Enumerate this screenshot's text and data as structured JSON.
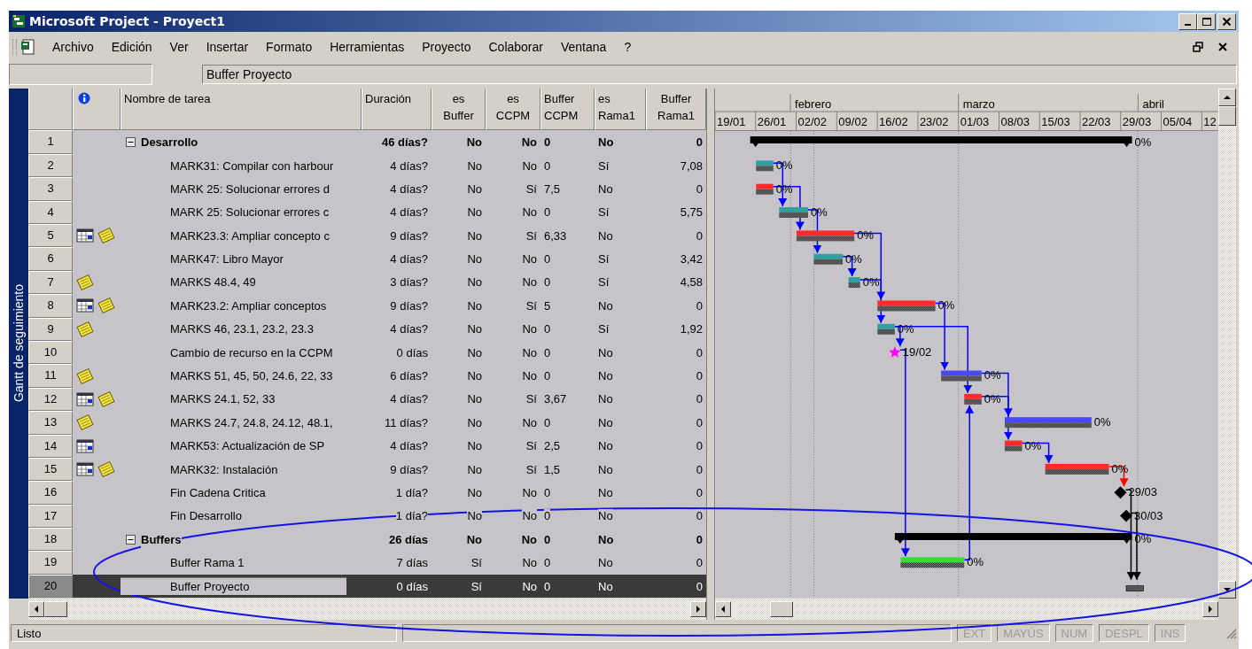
{
  "window": {
    "title": "Microsoft Project - Proyect1"
  },
  "menu": [
    "Archivo",
    "Edición",
    "Ver",
    "Insertar",
    "Formato",
    "Herramientas",
    "Proyecto",
    "Colaborar",
    "Ventana",
    "?"
  ],
  "entry_bar": {
    "value": "Buffer Proyecto"
  },
  "view_bar": {
    "label": "Gantt de seguimiento"
  },
  "columns": [
    "Nombre de tarea",
    "Duración",
    "es Buffer",
    "es CCPM",
    "Buffer CCPM",
    "es Rama1",
    "Buffer Rama1"
  ],
  "tasks": [
    {
      "row_number": "1",
      "name": "Desarrollo",
      "expanded": true,
      "selected": false,
      "values": [
        "46 días?",
        "No",
        "No",
        "0",
        "No",
        "0"
      ],
      "children": [
        {
          "row_number": "2",
          "name": "MARK31: Compilar con harbour",
          "selected": false,
          "values": [
            "4 días?",
            "No",
            "No",
            "0",
            "Sí",
            "7,08"
          ]
        },
        {
          "row_number": "3",
          "name": "MARK 25: Solucionar errores d",
          "selected": false,
          "values": [
            "4 días?",
            "No",
            "Sí",
            "7,5",
            "No",
            "0"
          ]
        },
        {
          "row_number": "4",
          "name": "MARK 25: Solucionar errores c",
          "selected": false,
          "values": [
            "4 días?",
            "No",
            "No",
            "0",
            "Sí",
            "5,75"
          ]
        },
        {
          "row_number": "5",
          "name": "MARK23.3: Ampliar concepto c",
          "selected": false,
          "indicators": [
            {
              "kind": "calendar"
            },
            {
              "kind": "note"
            }
          ],
          "values": [
            "9 días?",
            "No",
            "Sí",
            "6,33",
            "No",
            "0"
          ]
        },
        {
          "row_number": "6",
          "name": "MARK47: Libro Mayor",
          "selected": false,
          "values": [
            "4 días?",
            "No",
            "No",
            "0",
            "Sí",
            "3,42"
          ]
        },
        {
          "row_number": "7",
          "name": "MARKS 48.4, 49",
          "selected": false,
          "indicators": [
            {
              "kind": "note"
            }
          ],
          "values": [
            "3 días?",
            "No",
            "No",
            "0",
            "Sí",
            "4,58"
          ]
        },
        {
          "row_number": "8",
          "name": "MARK23.2: Ampliar conceptos",
          "selected": false,
          "indicators": [
            {
              "kind": "calendar"
            },
            {
              "kind": "note"
            }
          ],
          "values": [
            "9 días?",
            "No",
            "Sí",
            "5",
            "No",
            "0"
          ]
        },
        {
          "row_number": "9",
          "name": "MARKS 46, 23.1, 23.2, 23.3",
          "selected": false,
          "indicators": [
            {
              "kind": "note"
            }
          ],
          "values": [
            "4 días?",
            "No",
            "No",
            "0",
            "Sí",
            "1,92"
          ]
        },
        {
          "row_number": "10",
          "name": "Cambio de recurso en la CCPM",
          "selected": false,
          "values": [
            "0 días",
            "No",
            "No",
            "0",
            "No",
            "0"
          ]
        },
        {
          "row_number": "11",
          "name": "MARKS 51, 45, 50, 24.6, 22, 33",
          "selected": false,
          "indicators": [
            {
              "kind": "note"
            }
          ],
          "values": [
            "6 días?",
            "No",
            "No",
            "0",
            "No",
            "0"
          ]
        },
        {
          "row_number": "12",
          "name": "MARKS 24.1, 52, 33",
          "selected": false,
          "indicators": [
            {
              "kind": "calendar"
            },
            {
              "kind": "note"
            }
          ],
          "values": [
            "4 días?",
            "No",
            "Sí",
            "3,67",
            "No",
            "0"
          ]
        },
        {
          "row_number": "13",
          "name": "MARKS 24.7, 24.8, 24.12, 48.1,",
          "selected": false,
          "indicators": [
            {
              "kind": "note"
            }
          ],
          "values": [
            "11 días?",
            "No",
            "No",
            "0",
            "No",
            "0"
          ]
        },
        {
          "row_number": "14",
          "name": "MARK53: Actualización de SP",
          "selected": false,
          "indicators": [
            {
              "kind": "calendar"
            }
          ],
          "values": [
            "4 días?",
            "No",
            "Sí",
            "2,5",
            "No",
            "0"
          ]
        },
        {
          "row_number": "15",
          "name": "MARK32: Instalación",
          "selected": false,
          "indicators": [
            {
              "kind": "calendar"
            },
            {
              "kind": "note"
            }
          ],
          "values": [
            "9 días?",
            "No",
            "Sí",
            "1,5",
            "No",
            "0"
          ]
        },
        {
          "row_number": "16",
          "name": "Fin Cadena Critica",
          "selected": false,
          "values": [
            "1 día?",
            "No",
            "No",
            "0",
            "No",
            "0"
          ]
        },
        {
          "row_number": "17",
          "name": "Fin Desarrollo",
          "selected": false,
          "values": [
            "1 día?",
            "No",
            "No",
            "0",
            "No",
            "0"
          ]
        }
      ]
    },
    {
      "row_number": "18",
      "name": "Buffers",
      "expanded": true,
      "selected": false,
      "values": [
        "26 días",
        "No",
        "No",
        "0",
        "No",
        "0"
      ],
      "children": [
        {
          "row_number": "19",
          "name": "Buffer Rama 1",
          "selected": false,
          "values": [
            "7 días",
            "Sí",
            "No",
            "0",
            "No",
            "0"
          ]
        },
        {
          "row_number": "20",
          "name": "Buffer Proyecto",
          "selected": true,
          "values": [
            "0 días",
            "Sí",
            "No",
            "0",
            "No",
            "0"
          ]
        }
      ]
    }
  ],
  "gantt": {
    "months": [
      "febrero",
      "marzo",
      "abril"
    ],
    "weeks": [
      "19/01",
      "26/01",
      "02/02",
      "09/02",
      "16/02",
      "23/02",
      "01/03",
      "08/03",
      "15/03",
      "22/03",
      "29/03",
      "05/04",
      "12"
    ],
    "bars": [
      {
        "kind": "summary",
        "label": "0%"
      },
      {
        "kind": "task",
        "color": "#2f9f9f",
        "label": "0%"
      },
      {
        "kind": "task",
        "color": "#ff2a2a",
        "label": "0%"
      },
      {
        "kind": "task",
        "color": "#2f9f9f",
        "label": "0%"
      },
      {
        "kind": "task",
        "color": "#ff2a2a",
        "label": "0%"
      },
      {
        "kind": "task",
        "color": "#2f9f9f",
        "label": "0%"
      },
      {
        "kind": "task",
        "color": "#2f9f9f",
        "label": "0%"
      },
      {
        "kind": "task",
        "color": "#ff2a2a",
        "label": "0%"
      },
      {
        "kind": "task",
        "color": "#2f9f9f",
        "label": "0%"
      },
      {
        "kind": "star",
        "color": "#ff00ff",
        "label": "19/02"
      },
      {
        "kind": "task",
        "color": "#4848ff",
        "label": "0%"
      },
      {
        "kind": "task",
        "color": "#ff2a2a",
        "label": "0%"
      },
      {
        "kind": "task",
        "color": "#4848ff",
        "label": "0%"
      },
      {
        "kind": "task",
        "color": "#ff2a2a",
        "label": "0%"
      },
      {
        "kind": "task",
        "color": "#ff2a2a",
        "label": "0%"
      },
      {
        "kind": "milestone",
        "color": "#000000",
        "label": "29/03"
      },
      {
        "kind": "milestone",
        "color": "#000000",
        "label": "30/03"
      },
      {
        "kind": "summary",
        "label": "0%"
      },
      {
        "kind": "task",
        "color": "#30e030",
        "label": "0%"
      },
      {
        "kind": "baseline"
      }
    ],
    "links": [
      {
        "color": "#0000ff"
      },
      {
        "color": "#0000ff"
      },
      {
        "color": "#0000ff"
      },
      {
        "color": "#0000ff"
      },
      {
        "color": "#0000ff"
      },
      {
        "color": "#0000ff"
      },
      {
        "color": "#0000ff"
      },
      {
        "color": "#0000ff"
      },
      {
        "color": "#0000ff"
      },
      {
        "color": "#0000ff"
      },
      {
        "color": "#0000ff"
      },
      {
        "color": "#0000ff"
      },
      {
        "color": "#0000ff"
      },
      {
        "color": "#0000ff"
      },
      {
        "color": "#ff0000"
      },
      {
        "color": "#000000"
      },
      {
        "color": "#000000"
      }
    ]
  },
  "status_bar": {
    "text": "Listo",
    "indicators": [
      {
        "label": "EXT",
        "active": false
      },
      {
        "label": "MAYÚS",
        "active": false
      },
      {
        "label": "NUM",
        "active": false
      },
      {
        "label": "DESPL",
        "active": false
      },
      {
        "label": "INS",
        "active": false
      }
    ]
  }
}
